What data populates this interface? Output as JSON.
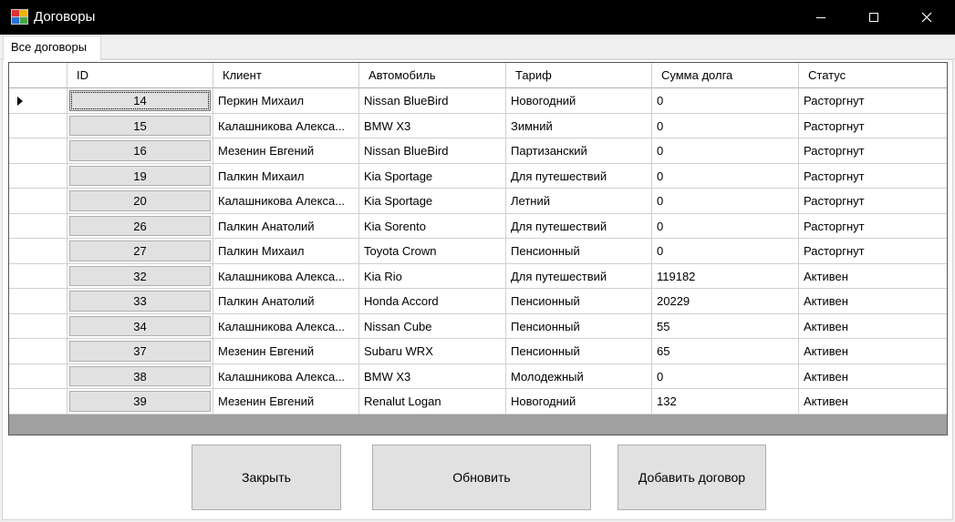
{
  "window": {
    "title": "Договоры"
  },
  "tabs": [
    {
      "label": "Все договоры"
    }
  ],
  "grid": {
    "columns": [
      "ID",
      "Клиент",
      "Автомобиль",
      "Тариф",
      "Сумма долга",
      "Статус"
    ],
    "rows": [
      {
        "id": "14",
        "client": "Перкин Михаил",
        "car": "Nissan BlueBird",
        "tariff": "Новогодний",
        "debt": "0",
        "status": "Расторгнут"
      },
      {
        "id": "15",
        "client": "Калашникова Алекса...",
        "car": "BMW X3",
        "tariff": "Зимний",
        "debt": "0",
        "status": "Расторгнут"
      },
      {
        "id": "16",
        "client": "Мезенин Евгений",
        "car": "Nissan BlueBird",
        "tariff": "Партизанский",
        "debt": "0",
        "status": "Расторгнут"
      },
      {
        "id": "19",
        "client": "Палкин Михаил",
        "car": "Kia Sportage",
        "tariff": "Для путешествий",
        "debt": "0",
        "status": "Расторгнут"
      },
      {
        "id": "20",
        "client": "Калашникова Алекса...",
        "car": "Kia Sportage",
        "tariff": "Летний",
        "debt": "0",
        "status": "Расторгнут"
      },
      {
        "id": "26",
        "client": "Палкин Анатолий",
        "car": "Kia Sorento",
        "tariff": "Для путешествий",
        "debt": "0",
        "status": "Расторгнут"
      },
      {
        "id": "27",
        "client": "Палкин Михаил",
        "car": "Toyota Crown",
        "tariff": "Пенсионный",
        "debt": "0",
        "status": "Расторгнут"
      },
      {
        "id": "32",
        "client": "Калашникова Алекса...",
        "car": "Kia Rio",
        "tariff": "Для путешествий",
        "debt": "119182",
        "status": "Активен"
      },
      {
        "id": "33",
        "client": "Палкин Анатолий",
        "car": "Honda Accord",
        "tariff": "Пенсионный",
        "debt": "20229",
        "status": "Активен"
      },
      {
        "id": "34",
        "client": "Калашникова Алекса...",
        "car": "Nissan Cube",
        "tariff": "Пенсионный",
        "debt": "55",
        "status": "Активен"
      },
      {
        "id": "37",
        "client": "Мезенин Евгений",
        "car": "Subaru WRX",
        "tariff": "Пенсионный",
        "debt": "65",
        "status": "Активен"
      },
      {
        "id": "38",
        "client": "Калашникова Алекса...",
        "car": "BMW X3",
        "tariff": "Молодежный",
        "debt": "0",
        "status": "Активен"
      },
      {
        "id": "39",
        "client": "Мезенин Евгений",
        "car": "Renalut Logan",
        "tariff": "Новогодний",
        "debt": "132",
        "status": "Активен"
      }
    ]
  },
  "buttons": {
    "close_label": "Закрыть",
    "refresh_label": "Обновить",
    "add_label": "Добавить договор"
  },
  "icons": {
    "app": "app-icon",
    "minimize": "minimize-icon",
    "maximize": "maximize-icon",
    "close": "close-icon",
    "row_selector": "current-row-arrow-icon"
  }
}
